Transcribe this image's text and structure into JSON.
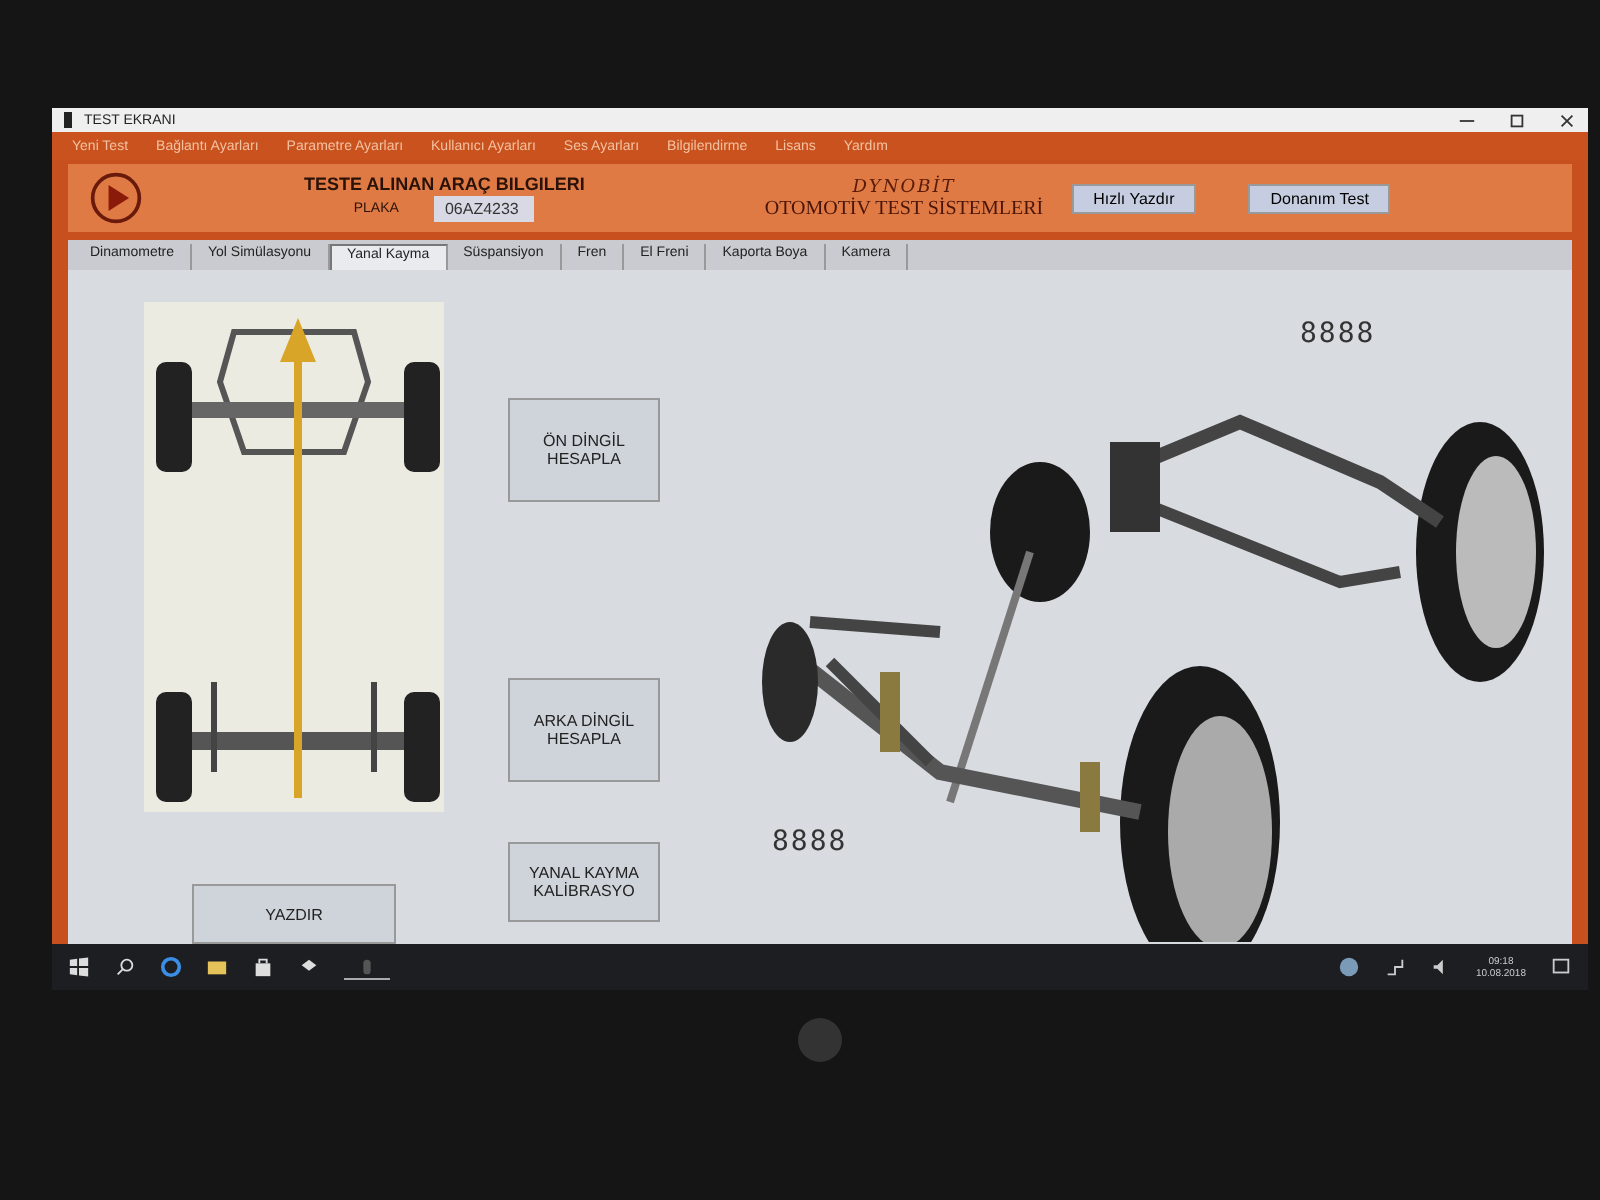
{
  "window": {
    "title": "TEST EKRANI"
  },
  "menu": [
    "Yeni Test",
    "Bağlantı Ayarları",
    "Parametre Ayarları",
    "Kullanıcı Ayarları",
    "Ses Ayarları",
    "Bilgilendirme",
    "Lisans",
    "Yardım"
  ],
  "header": {
    "title": "TESTE ALINAN ARAÇ BILGILERI",
    "plate_label": "PLAKA",
    "plate_value": "06AZ4233",
    "logo": "DYNOBİT",
    "subtitle": "OTOMOTİV TEST SİSTEMLERİ",
    "buttons": [
      "Hızlı Yazdır",
      "Donanım Test"
    ]
  },
  "tabs": [
    {
      "label": "Dinamometre",
      "selected": false
    },
    {
      "label": "Yol Simülasyonu",
      "selected": false
    },
    {
      "label": "Yanal Kayma",
      "selected": true
    },
    {
      "label": "Süspansiyon",
      "selected": false
    },
    {
      "label": "Fren",
      "selected": false
    },
    {
      "label": "El Freni",
      "selected": false
    },
    {
      "label": "Kaporta Boya",
      "selected": false
    },
    {
      "label": "Kamera",
      "selected": false
    }
  ],
  "panel": {
    "front_axle_button": "ÖN DİNGİL HESAPLA",
    "rear_axle_button": "ARKA DİNGİL HESAPLA",
    "print_button": "YAZDIR",
    "calibration_button": "YANAL KAYMA KALİBRASYO",
    "rear_display": "8888",
    "front_display": "8888"
  },
  "taskbar": {
    "time": "09:18",
    "date": "10.08.2018"
  }
}
